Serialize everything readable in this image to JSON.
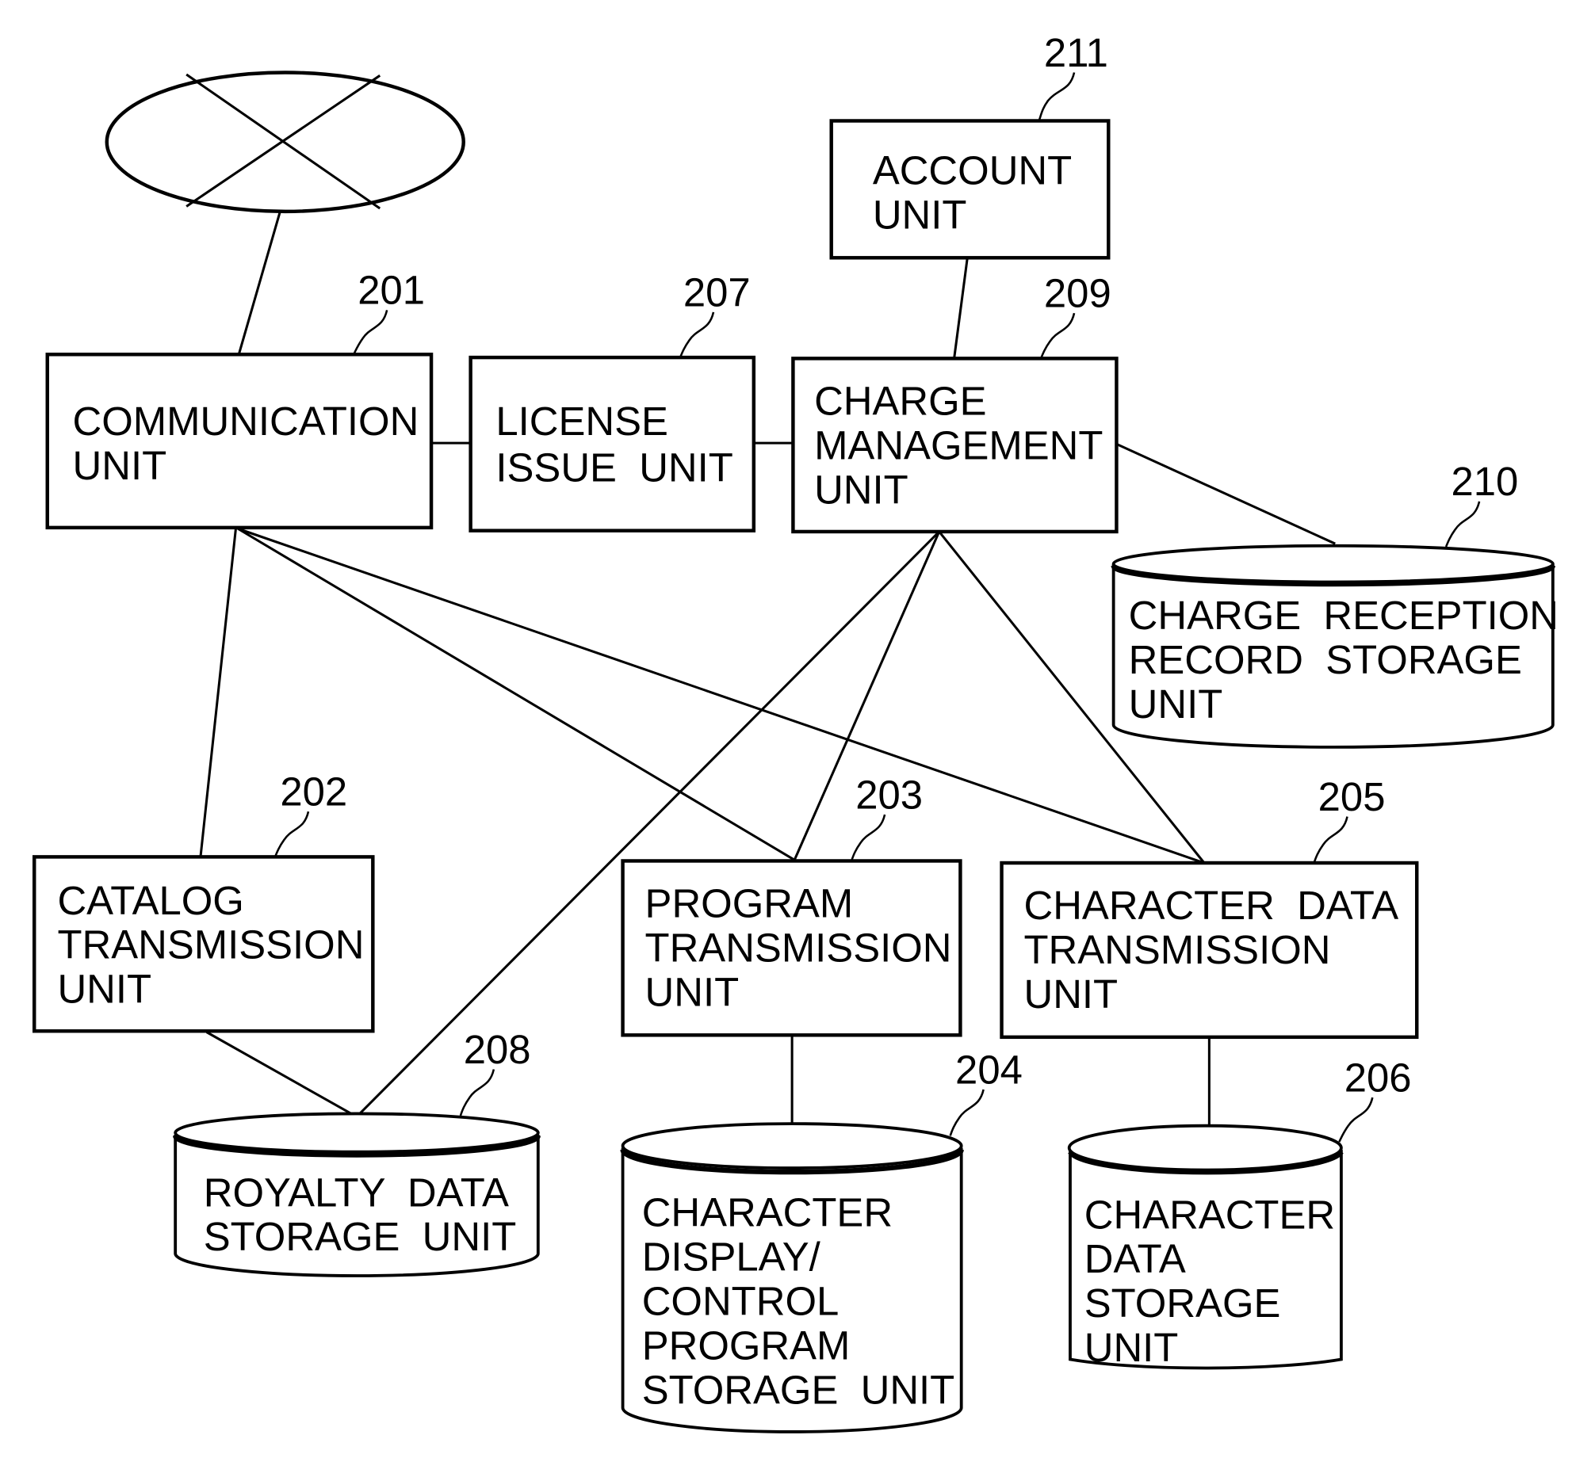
{
  "network": {
    "label": "network",
    "icon": "network-cloud-icon"
  },
  "units": {
    "communication": {
      "ref": "201",
      "lines": [
        "COMMUNICATION",
        "UNIT"
      ]
    },
    "catalog_transmission": {
      "ref": "202",
      "lines": [
        "CATALOG",
        "TRANSMISSION",
        "UNIT"
      ]
    },
    "program_transmission": {
      "ref": "203",
      "lines": [
        "PROGRAM",
        "TRANSMISSION",
        "UNIT"
      ]
    },
    "character_data_transmission": {
      "ref": "205",
      "lines": [
        "CHARACTER  DATA",
        "TRANSMISSION",
        "UNIT"
      ]
    },
    "license_issue": {
      "ref": "207",
      "lines": [
        "LICENSE",
        "ISSUE  UNIT"
      ]
    },
    "charge_management": {
      "ref": "209",
      "lines": [
        "CHARGE",
        "MANAGEMENT",
        "UNIT"
      ]
    },
    "account": {
      "ref": "211",
      "lines": [
        "ACCOUNT",
        "UNIT"
      ]
    }
  },
  "storage": {
    "character_display_control_program": {
      "ref": "204",
      "lines": [
        "CHARACTER",
        "DISPLAY/",
        "CONTROL",
        "PROGRAM",
        "STORAGE  UNIT"
      ]
    },
    "character_data": {
      "ref": "206",
      "lines": [
        "CHARACTER",
        "DATA",
        "STORAGE",
        "UNIT"
      ]
    },
    "royalty_data": {
      "ref": "208",
      "lines": [
        "ROYALTY  DATA",
        "STORAGE  UNIT"
      ]
    },
    "charge_reception_record": {
      "ref": "210",
      "lines": [
        "CHARGE  RECEPTION",
        "RECORD  STORAGE",
        "UNIT"
      ]
    }
  },
  "connections": [
    [
      "network",
      "communication"
    ],
    [
      "communication",
      "license_issue"
    ],
    [
      "license_issue",
      "charge_management"
    ],
    [
      "account",
      "charge_management"
    ],
    [
      "charge_management",
      "charge_reception_record"
    ],
    [
      "communication",
      "catalog_transmission"
    ],
    [
      "communication",
      "program_transmission"
    ],
    [
      "communication",
      "character_data_transmission"
    ],
    [
      "charge_management",
      "royalty_data"
    ],
    [
      "charge_management",
      "program_transmission"
    ],
    [
      "charge_management",
      "character_data_transmission"
    ],
    [
      "catalog_transmission",
      "royalty_data"
    ],
    [
      "program_transmission",
      "character_display_control_program"
    ],
    [
      "character_data_transmission",
      "character_data"
    ]
  ]
}
